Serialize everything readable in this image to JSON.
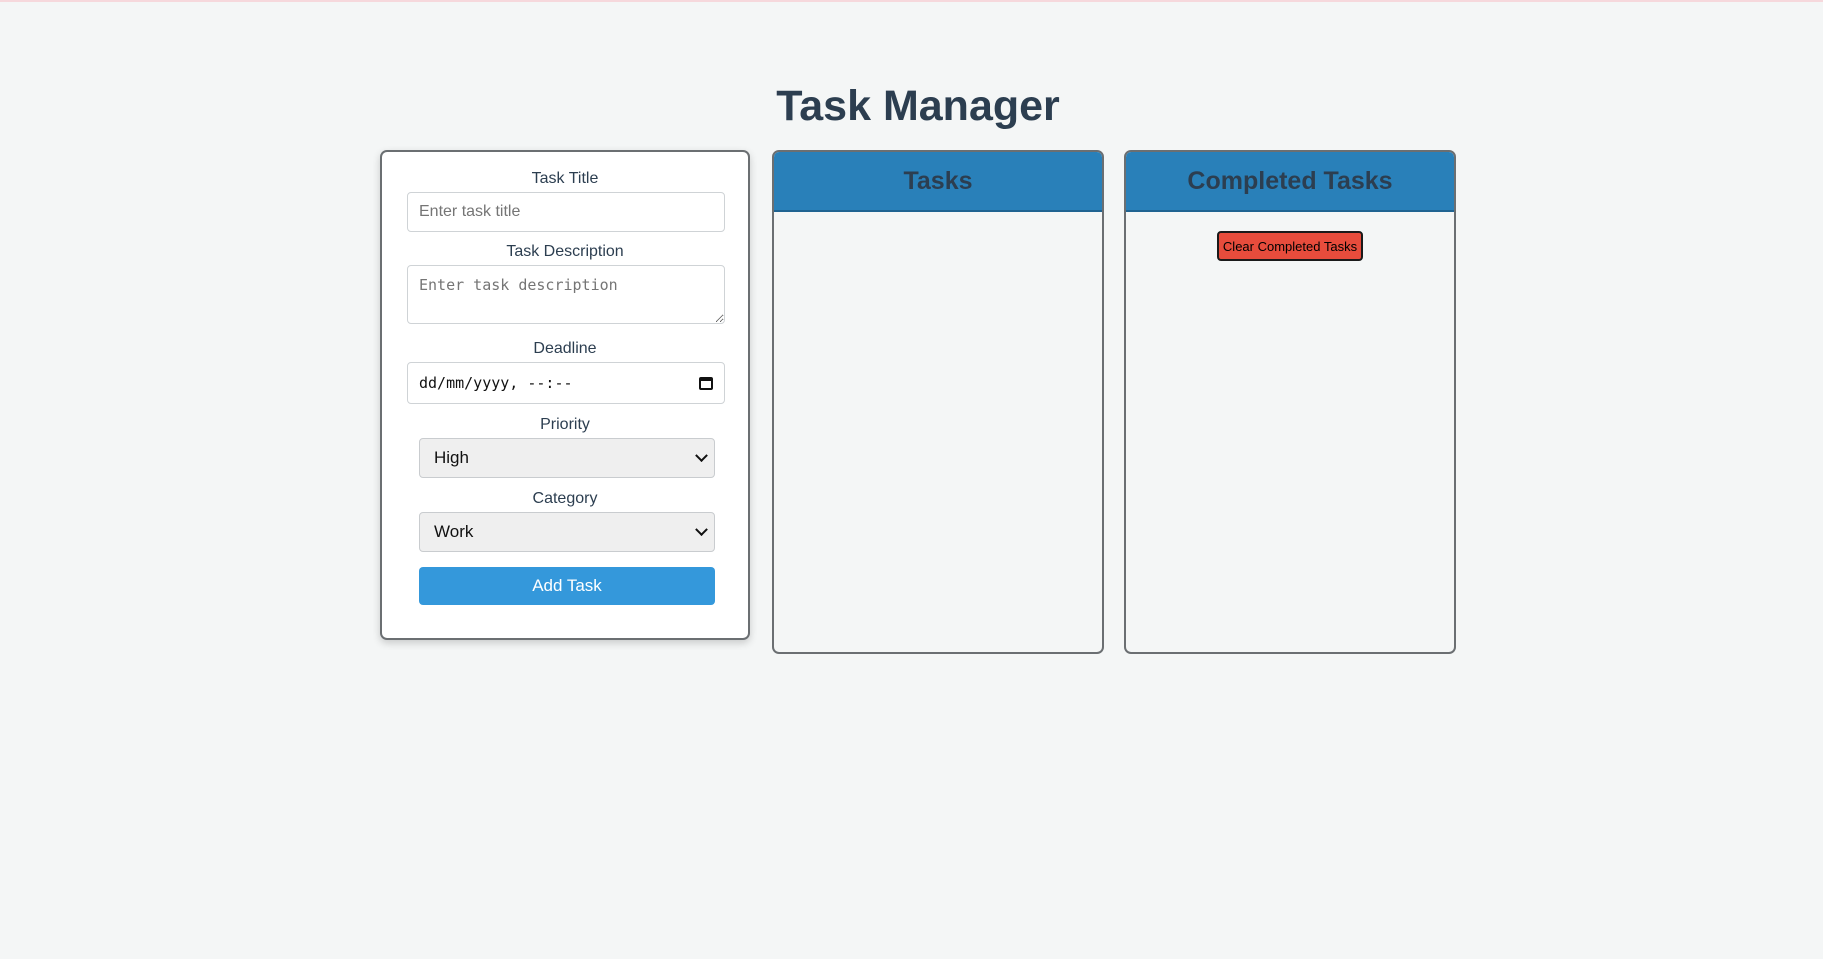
{
  "page": {
    "title": "Task Manager"
  },
  "form": {
    "title_label": "Task Title",
    "title_placeholder": "Enter task title",
    "title_value": "",
    "description_label": "Task Description",
    "description_placeholder": "Enter task description",
    "description_value": "",
    "deadline_label": "Deadline",
    "deadline_value": "dd/mm/yyyy, --:--",
    "priority_label": "Priority",
    "priority_selected": "High",
    "category_label": "Category",
    "category_selected": "Work",
    "add_button_label": "Add Task"
  },
  "tasks_panel": {
    "header": "Tasks",
    "items": []
  },
  "completed_panel": {
    "header": "Completed Tasks",
    "clear_button_label": "Clear Completed Tasks",
    "items": []
  },
  "colors": {
    "background": "#f4f6f6",
    "header_blue": "#2980b9",
    "button_blue": "#3498db",
    "clear_red": "#e74c3c",
    "text_dark": "#2c3e50"
  }
}
